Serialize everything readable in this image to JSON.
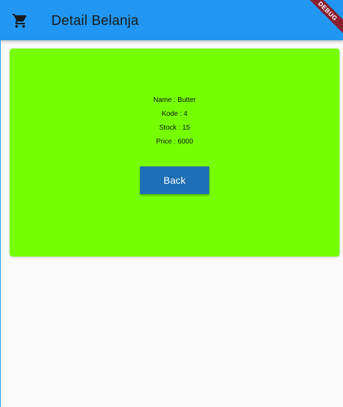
{
  "app_bar": {
    "title": "Detail Belanja",
    "icon": "shopping-cart-icon",
    "background_color": "#2196f3"
  },
  "debug_banner": {
    "label": "DEBUG",
    "color": "#8b1e2f"
  },
  "detail_card": {
    "background_color": "#76ff03",
    "lines": [
      "Name : Butter",
      "Kode : 4",
      "Stock : 15",
      "Price : 6000"
    ],
    "back_label": "Back",
    "button_color": "#1e6fb5"
  }
}
